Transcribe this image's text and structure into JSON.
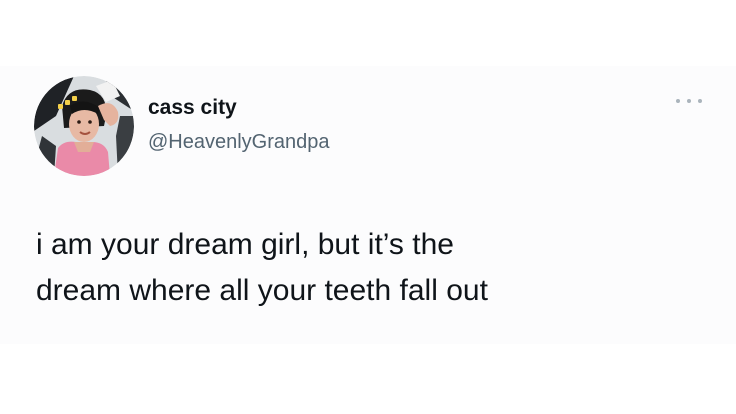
{
  "tweet": {
    "author": {
      "display_name": "cass city",
      "handle": "@HeavenlyGrandpa",
      "avatar_icon": "profile-photo"
    },
    "more_icon": "more-horizontal-icon",
    "text_lines": [
      "i am your dream girl, but it’s the",
      "dream where all your teeth fall out"
    ]
  },
  "colors": {
    "text_primary": "#0f1419",
    "text_secondary": "#536471",
    "background": "#ffffff"
  }
}
